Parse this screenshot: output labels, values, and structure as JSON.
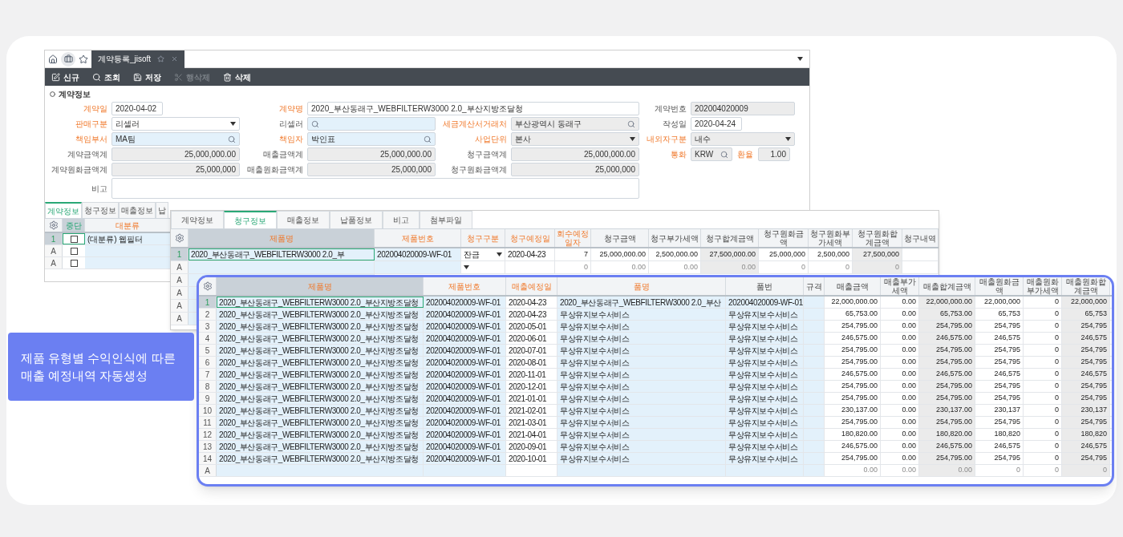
{
  "callout": {
    "text": "제품 유형별 수익인식에 따른\n매출 예정내역 자동생성"
  },
  "window_tabs": [
    {
      "label": "계약등록_jisoft",
      "selected": true
    }
  ],
  "toolbar": [
    {
      "label": "신규",
      "kind": "new",
      "disabled": false
    },
    {
      "label": "조회",
      "kind": "search",
      "disabled": false
    },
    {
      "label": "저장",
      "kind": "save",
      "disabled": false
    },
    {
      "label": "행삭제",
      "kind": "cut",
      "disabled": true
    },
    {
      "label": "삭제",
      "kind": "delete",
      "disabled": false
    }
  ],
  "section_title": "계약정보",
  "form_rows": [
    [
      {
        "label": "계약일",
        "required": true,
        "kind": "date",
        "value": "2020-04-02",
        "readonly": false
      },
      {
        "label": "계약명",
        "required": true,
        "kind": "wide_text",
        "value": "2020_부산동래구_WEBFILTERW3000 2.0_부산지방조달청",
        "readonly": false
      },
      {
        "label": "계약번호",
        "required": false,
        "kind": "text",
        "value": "202004020009",
        "readonly": true
      }
    ],
    [
      {
        "label": "판매구분",
        "required": true,
        "kind": "select",
        "value": "리셀러",
        "readonly": false
      },
      {
        "label": "리셀러",
        "required": false,
        "kind": "search",
        "readonly": false
      },
      {
        "label": "세금계산서거래처",
        "required": true,
        "kind": "search",
        "value": "부산광역시 동래구",
        "readonly": true
      },
      {
        "label": "작성일",
        "required": false,
        "kind": "date",
        "value": "2020-04-24",
        "readonly": false
      }
    ],
    [
      {
        "label": "책임부서",
        "required": true,
        "kind": "search",
        "value": "MA팀",
        "readonly": false
      },
      {
        "label": "책임자",
        "required": true,
        "kind": "search",
        "value": "박인표",
        "readonly": false
      },
      {
        "label": "사업단위",
        "required": true,
        "kind": "select",
        "value": "본사",
        "readonly": true
      },
      {
        "label": "내외자구분",
        "required": true,
        "kind": "select",
        "value": "내수",
        "readonly": true
      }
    ],
    [
      {
        "label": "계약금액계",
        "required": false,
        "kind": "amount",
        "value": "25,000,000.00",
        "readonly": true
      },
      {
        "label": "매출금액계",
        "required": false,
        "kind": "amount",
        "value": "25,000,000.00",
        "readonly": true
      },
      {
        "label": "청구금액계",
        "required": false,
        "kind": "amount",
        "value": "25,000,000.00",
        "readonly": true
      },
      {
        "label": "통화",
        "required": true,
        "kind": "currency",
        "value": "KRW",
        "readonly": true,
        "rate": {
          "label": "환율",
          "required": true,
          "value": "1.00"
        }
      }
    ],
    [
      {
        "label": "계약원화금액계",
        "required": false,
        "kind": "amount",
        "value": "25,000,000",
        "readonly": true
      },
      {
        "label": "매출원화금액계",
        "required": false,
        "kind": "amount",
        "value": "25,000,000",
        "readonly": true
      },
      {
        "label": "청구원화금액계",
        "required": false,
        "kind": "amount",
        "value": "25,000,000",
        "readonly": true
      }
    ],
    [
      {
        "label": "비고",
        "required": false,
        "kind": "textarea",
        "readonly": false
      }
    ]
  ],
  "detail_tabs": [
    {
      "label": "계약정보",
      "selected": true
    },
    {
      "label": "청구정보",
      "selected": false
    },
    {
      "label": "매출정보",
      "selected": false
    },
    {
      "label": "납",
      "selected": false
    }
  ],
  "category_grid": {
    "columns": [
      {
        "label": "중단",
        "required": false,
        "selected": true
      },
      {
        "label": "대분류",
        "required": true,
        "selected": false
      }
    ],
    "rows": [
      {
        "marker": "1",
        "selected": true,
        "checked": false,
        "category": "(대분류) 웹필터"
      },
      {
        "marker": "A",
        "selected": false,
        "checked": false
      },
      {
        "marker": "A",
        "selected": false,
        "checked": false
      }
    ]
  },
  "billing_window": {
    "tabs": [
      {
        "label": "계약정보",
        "selected": false
      },
      {
        "label": "청구정보",
        "selected": true
      },
      {
        "label": "매출정보",
        "selected": false
      },
      {
        "label": "납품정보",
        "selected": false
      },
      {
        "label": "비고",
        "selected": false
      },
      {
        "label": "첨부파일",
        "selected": false
      }
    ],
    "columns": [
      {
        "label": "제품명",
        "required": true,
        "selected": true,
        "kind": "key"
      },
      {
        "label": "제품번호",
        "required": true,
        "selected": false,
        "kind": "key"
      },
      {
        "label": "청구구분",
        "required": true,
        "selected": false,
        "kind": "select"
      },
      {
        "label": "청구예정일",
        "required": true,
        "selected": false,
        "kind": "date"
      },
      {
        "label": "회수예정일자",
        "required": true,
        "selected": false,
        "kind": "amount"
      },
      {
        "label": "청구금액",
        "required": false,
        "selected": false,
        "kind": "amount"
      },
      {
        "label": "청구부가세액",
        "required": false,
        "selected": false,
        "kind": "amount"
      },
      {
        "label": "청구합계금액",
        "required": false,
        "selected": false,
        "kind": "total"
      },
      {
        "label": "청구원화금액",
        "required": false,
        "selected": false,
        "kind": "amount"
      },
      {
        "label": "청구원화부가세액",
        "required": false,
        "selected": false,
        "kind": "amount"
      },
      {
        "label": "청구원화합계금액",
        "required": false,
        "selected": false,
        "kind": "total"
      },
      {
        "label": "청구내역",
        "required": false,
        "selected": false,
        "kind": "date"
      }
    ],
    "rows": [
      {
        "marker": "1",
        "kind": "data",
        "selected": true,
        "cells": [
          "2020_부산동래구_WEBFILTERW3000 2.0_부",
          "202004020009-WF-01",
          "잔금",
          "2020-04-23",
          "7",
          "25,000,000.00",
          "2,500,000.00",
          "27,500,000.00",
          "25,000,000",
          "2,500,000",
          "27,500,000",
          null
        ]
      },
      {
        "marker": "A",
        "kind": "new",
        "selected": false,
        "cells": [
          null,
          null,
          null,
          null,
          "0",
          "0.00",
          "0.00",
          "0.00",
          "0",
          "0",
          "0",
          null
        ]
      },
      {
        "marker": "A",
        "kind": "new",
        "selected": false
      },
      {
        "marker": "A",
        "kind": "new",
        "selected": false
      },
      {
        "marker": "A",
        "kind": "new",
        "selected": false
      },
      {
        "marker": "A",
        "kind": "new",
        "selected": false
      }
    ]
  },
  "sales_window": {
    "columns": [
      {
        "label": "제품명",
        "required": true,
        "selected": true,
        "kind": "key"
      },
      {
        "label": "제품번호",
        "required": true,
        "selected": false,
        "kind": "key"
      },
      {
        "label": "매출예정일",
        "required": true,
        "selected": false,
        "kind": "date"
      },
      {
        "label": "품명",
        "required": true,
        "selected": false,
        "kind": "key"
      },
      {
        "label": "품번",
        "required": false,
        "selected": false,
        "kind": "key"
      },
      {
        "label": "규격",
        "required": false,
        "selected": false,
        "kind": "key"
      },
      {
        "label": "매출금액",
        "required": false,
        "selected": false,
        "kind": "amount"
      },
      {
        "label": "매출부가세액",
        "required": false,
        "selected": false,
        "kind": "amount"
      },
      {
        "label": "매출합계금액",
        "required": false,
        "selected": false,
        "kind": "total"
      },
      {
        "label": "매출원화금액",
        "required": false,
        "selected": false,
        "kind": "amount"
      },
      {
        "label": "매출원화부가세액",
        "required": false,
        "selected": false,
        "kind": "amount"
      },
      {
        "label": "매출원화합계금액",
        "required": false,
        "selected": false,
        "kind": "total"
      }
    ],
    "rows": [
      {
        "marker": "1",
        "kind": "data",
        "selected": true,
        "cells": [
          "2020_부산동래구_WEBFILTERW3000 2.0_부산지방조달청",
          "202004020009-WF-01",
          "2020-04-23",
          "2020_부산동래구_WEBFILTERW3000 2.0_부산",
          "202004020009-WF-01",
          null,
          "22,000,000.00",
          "0.00",
          "22,000,000.00",
          "22,000,000",
          "0",
          "22,000,000"
        ]
      },
      {
        "marker": "2",
        "kind": "data",
        "selected": false,
        "cells": [
          "2020_부산동래구_WEBFILTERW3000 2.0_부산지방조달청",
          "202004020009-WF-01",
          "2020-04-23",
          "무상유지보수서비스",
          "무상유지보수서비스",
          null,
          "65,753.00",
          "0.00",
          "65,753.00",
          "65,753",
          "0",
          "65,753"
        ]
      },
      {
        "marker": "3",
        "kind": "data",
        "selected": false,
        "cells": [
          "2020_부산동래구_WEBFILTERW3000 2.0_부산지방조달청",
          "202004020009-WF-01",
          "2020-05-01",
          "무상유지보수서비스",
          "무상유지보수서비스",
          null,
          "254,795.00",
          "0.00",
          "254,795.00",
          "254,795",
          "0",
          "254,795"
        ]
      },
      {
        "marker": "4",
        "kind": "data",
        "selected": false,
        "cells": [
          "2020_부산동래구_WEBFILTERW3000 2.0_부산지방조달청",
          "202004020009-WF-01",
          "2020-06-01",
          "무상유지보수서비스",
          "무상유지보수서비스",
          null,
          "246,575.00",
          "0.00",
          "246,575.00",
          "246,575",
          "0",
          "246,575"
        ]
      },
      {
        "marker": "5",
        "kind": "data",
        "selected": false,
        "cells": [
          "2020_부산동래구_WEBFILTERW3000 2.0_부산지방조달청",
          "202004020009-WF-01",
          "2020-07-01",
          "무상유지보수서비스",
          "무상유지보수서비스",
          null,
          "254,795.00",
          "0.00",
          "254,795.00",
          "254,795",
          "0",
          "254,795"
        ]
      },
      {
        "marker": "6",
        "kind": "data",
        "selected": false,
        "cells": [
          "2020_부산동래구_WEBFILTERW3000 2.0_부산지방조달청",
          "202004020009-WF-01",
          "2020-08-01",
          "무상유지보수서비스",
          "무상유지보수서비스",
          null,
          "254,795.00",
          "0.00",
          "254,795.00",
          "254,795",
          "0",
          "254,795"
        ]
      },
      {
        "marker": "7",
        "kind": "data",
        "selected": false,
        "cells": [
          "2020_부산동래구_WEBFILTERW3000 2.0_부산지방조달청",
          "202004020009-WF-01",
          "2020-11-01",
          "무상유지보수서비스",
          "무상유지보수서비스",
          null,
          "246,575.00",
          "0.00",
          "246,575.00",
          "246,575",
          "0",
          "246,575"
        ]
      },
      {
        "marker": "8",
        "kind": "data",
        "selected": false,
        "cells": [
          "2020_부산동래구_WEBFILTERW3000 2.0_부산지방조달청",
          "202004020009-WF-01",
          "2020-12-01",
          "무상유지보수서비스",
          "무상유지보수서비스",
          null,
          "254,795.00",
          "0.00",
          "254,795.00",
          "254,795",
          "0",
          "254,795"
        ]
      },
      {
        "marker": "9",
        "kind": "data",
        "selected": false,
        "cells": [
          "2020_부산동래구_WEBFILTERW3000 2.0_부산지방조달청",
          "202004020009-WF-01",
          "2021-01-01",
          "무상유지보수서비스",
          "무상유지보수서비스",
          null,
          "254,795.00",
          "0.00",
          "254,795.00",
          "254,795",
          "0",
          "254,795"
        ]
      },
      {
        "marker": "10",
        "kind": "data",
        "selected": false,
        "cells": [
          "2020_부산동래구_WEBFILTERW3000 2.0_부산지방조달청",
          "202004020009-WF-01",
          "2021-02-01",
          "무상유지보수서비스",
          "무상유지보수서비스",
          null,
          "230,137.00",
          "0.00",
          "230,137.00",
          "230,137",
          "0",
          "230,137"
        ]
      },
      {
        "marker": "11",
        "kind": "data",
        "selected": false,
        "cells": [
          "2020_부산동래구_WEBFILTERW3000 2.0_부산지방조달청",
          "202004020009-WF-01",
          "2021-03-01",
          "무상유지보수서비스",
          "무상유지보수서비스",
          null,
          "254,795.00",
          "0.00",
          "254,795.00",
          "254,795",
          "0",
          "254,795"
        ]
      },
      {
        "marker": "12",
        "kind": "data",
        "selected": false,
        "cells": [
          "2020_부산동래구_WEBFILTERW3000 2.0_부산지방조달청",
          "202004020009-WF-01",
          "2021-04-01",
          "무상유지보수서비스",
          "무상유지보수서비스",
          null,
          "180,820.00",
          "0.00",
          "180,820.00",
          "180,820",
          "0",
          "180,820"
        ]
      },
      {
        "marker": "13",
        "kind": "data",
        "selected": false,
        "cells": [
          "2020_부산동래구_WEBFILTERW3000 2.0_부산지방조달청",
          "202004020009-WF-01",
          "2020-09-01",
          "무상유지보수서비스",
          "무상유지보수서비스",
          null,
          "246,575.00",
          "0.00",
          "246,575.00",
          "246,575",
          "0",
          "246,575"
        ]
      },
      {
        "marker": "14",
        "kind": "data",
        "selected": false,
        "cells": [
          "2020_부산동래구_WEBFILTERW3000 2.0_부산지방조달청",
          "202004020009-WF-01",
          "2020-10-01",
          "무상유지보수서비스",
          "무상유지보수서비스",
          null,
          "254,795.00",
          "0.00",
          "254,795.00",
          "254,795",
          "0",
          "254,795"
        ]
      },
      {
        "marker": "A",
        "kind": "new",
        "selected": false,
        "cells": [
          null,
          null,
          null,
          null,
          null,
          null,
          "0.00",
          "0.00",
          "0.00",
          "0",
          "0",
          "0"
        ]
      }
    ]
  }
}
